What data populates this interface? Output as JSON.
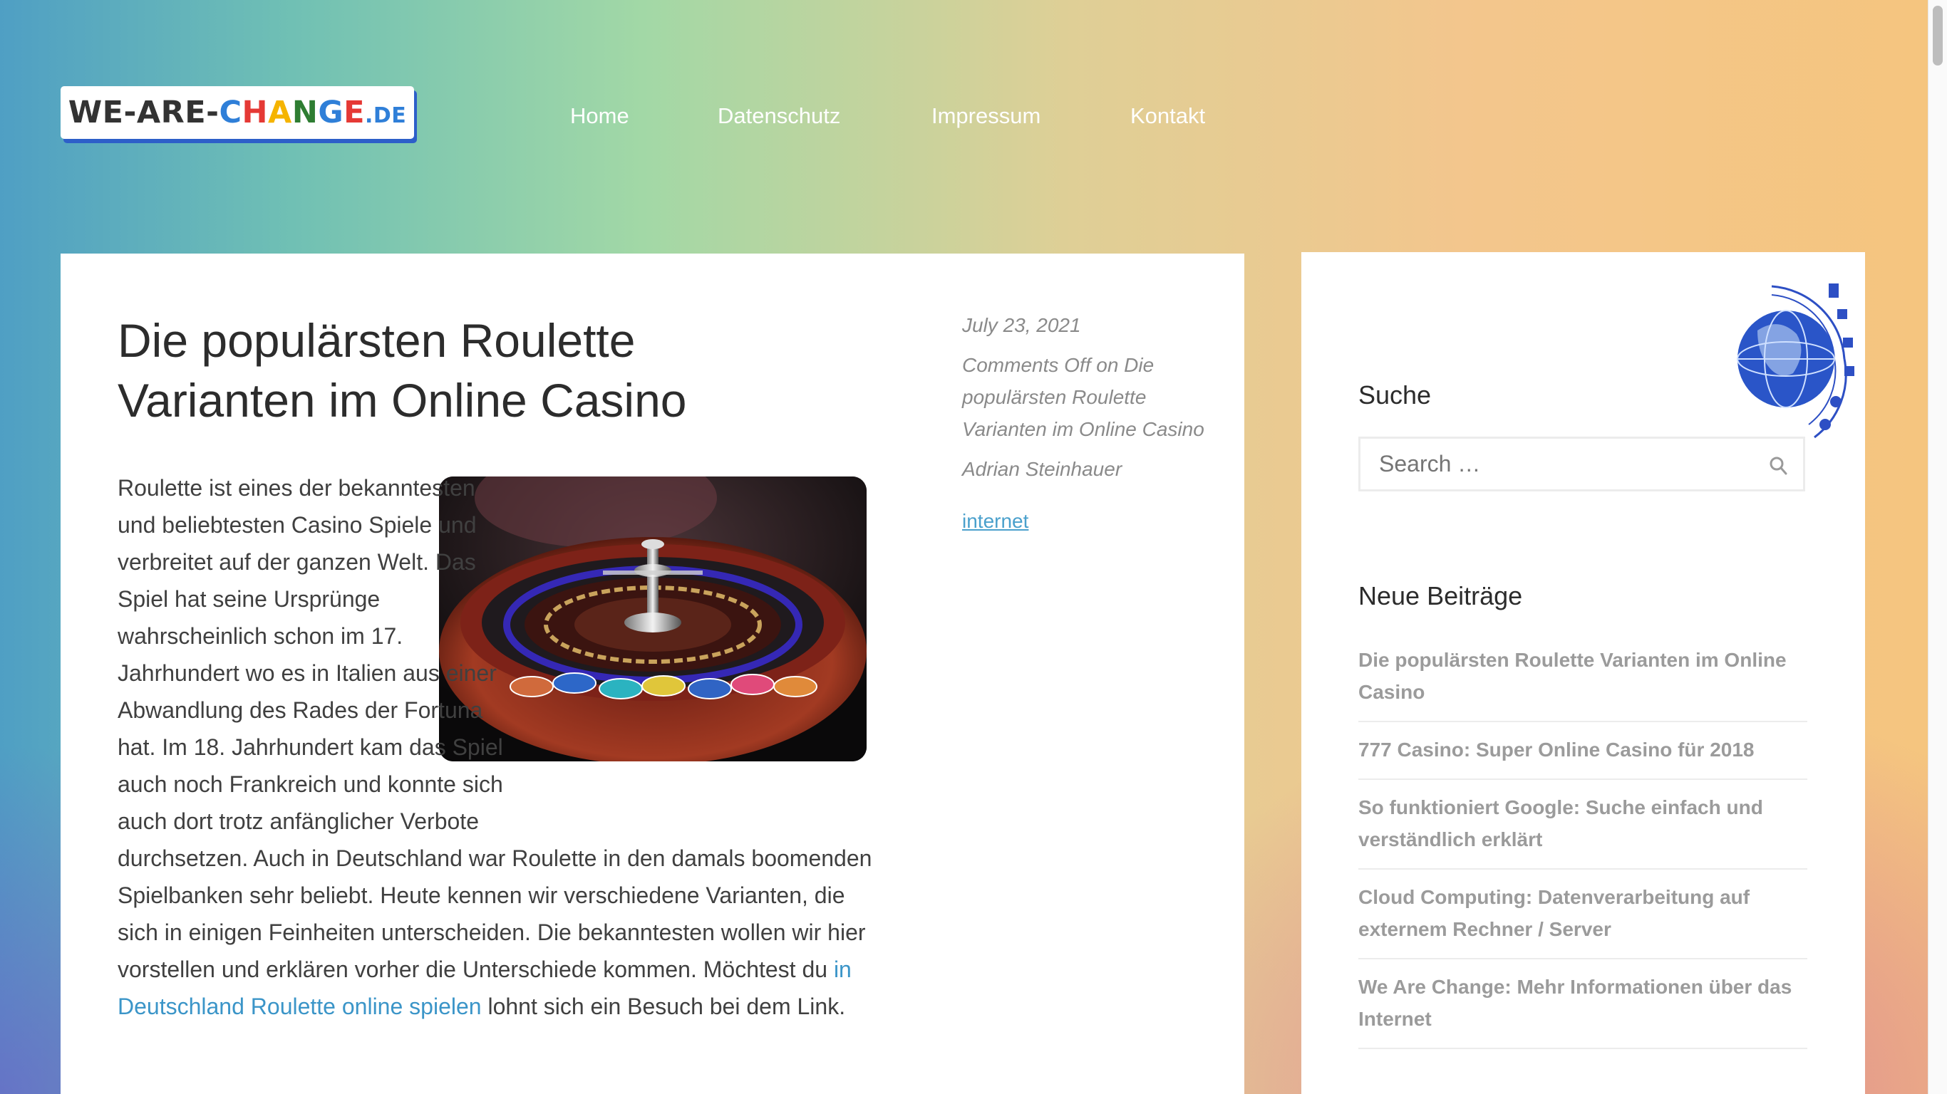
{
  "logo": {
    "main": "WE-ARE-",
    "change_letters": [
      "C",
      "H",
      "A",
      "N",
      "G",
      "E"
    ],
    "change_colors": [
      "#2f7fd8",
      "#e53935",
      "#f5b400",
      "#2e7d32",
      "#2f7fd8",
      "#e53935"
    ],
    "suffix": ".DE"
  },
  "nav": {
    "items": [
      {
        "label": "Home"
      },
      {
        "label": "Datenschutz"
      },
      {
        "label": "Impressum"
      },
      {
        "label": "Kontakt"
      }
    ]
  },
  "post": {
    "title": "Die populärsten Roulette Varianten im Online Casino",
    "body_before_link": "Roulette ist eines der bekanntesten und beliebtesten Casino Spiele und verbreitet auf der ganzen Welt. Das Spiel hat seine Ursprünge wahrscheinlich schon im 17. Jahrhundert wo es in Italien aus einer Abwandlung des Rades der Fortuna hat. Im 18. Jahrhundert kam das Spiel auch noch Frankreich und konnte sich auch dort trotz anfänglicher Verbote durchsetzen. Auch in Deutschland war Roulette in den damals boomenden Spielbanken sehr beliebt. Heute kennen wir verschiedene Varianten, die sich in einigen Feinheiten unterscheiden. Die bekanntesten wollen wir hier vorstellen und erklären vorher die Unterschiede kommen. Möchtest du ",
    "link_text": "in Deutschland Roulette online spielen",
    "body_after_link": " lohnt sich ein Besuch bei dem Link."
  },
  "meta": {
    "date": "July 23, 2021",
    "comments": "Comments Off on Die populärsten Roulette Varianten im Online Casino",
    "author": "Adrian Steinhauer",
    "category": "internet"
  },
  "sidebar": {
    "search_title": "Suche",
    "search_placeholder": "Search …",
    "recent_title": "Neue Beiträge",
    "recent_posts": [
      "Die populärsten Roulette Varianten im Online Casino",
      "777 Casino: Super Online Casino für 2018",
      "So funktioniert Google: Suche einfach und verständlich erklärt",
      "Cloud Computing: Datenverarbeitung auf externem Rechner / Server",
      "We Are Change: Mehr Informationen über das Internet"
    ]
  },
  "colors": {
    "link": "#3b95c8",
    "logo_shadow": "#2d5fc9",
    "title_text": "#2c2c2c",
    "meta_text": "#8a8a8a",
    "recent_text": "#9b9b9b"
  }
}
